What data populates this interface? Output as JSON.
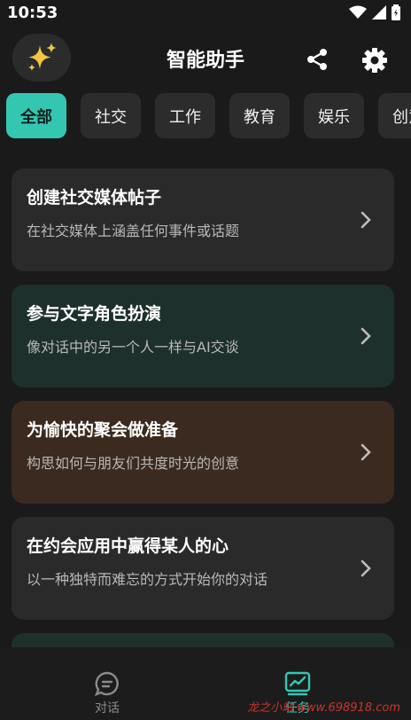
{
  "status": {
    "time": "10:53"
  },
  "header": {
    "title": "智能助手",
    "avatar_icon": "sparkles-icon",
    "share_icon": "share-icon",
    "settings_icon": "gear-icon"
  },
  "tabs": [
    {
      "label": "全部",
      "active": true
    },
    {
      "label": "社交"
    },
    {
      "label": "工作"
    },
    {
      "label": "教育"
    },
    {
      "label": "娱乐"
    },
    {
      "label": "创意"
    }
  ],
  "cards": [
    {
      "title": "创建社交媒体帖子",
      "subtitle": "在社交媒体上涵盖任何事件或话题",
      "bg": "#2a2a2a"
    },
    {
      "title": "参与文字角色扮演",
      "subtitle": "像对话中的另一个人一样与AI交谈",
      "bg": "#1e302c"
    },
    {
      "title": "为愉快的聚会做准备",
      "subtitle": "构思如何与朋友们共度时光的创意",
      "bg": "#3a2a20"
    },
    {
      "title": "在约会应用中赢得某人的心",
      "subtitle": "以一种独特而难忘的方式开始你的对话",
      "bg": "#2a2a2a"
    }
  ],
  "nav": [
    {
      "label": "对话",
      "icon": "chat-bubble-icon",
      "color": "#8a8a8a"
    },
    {
      "label": "任务",
      "icon": "chart-icon",
      "color": "#33c7b2"
    }
  ],
  "watermark": "龙之小站 www.698918.com"
}
